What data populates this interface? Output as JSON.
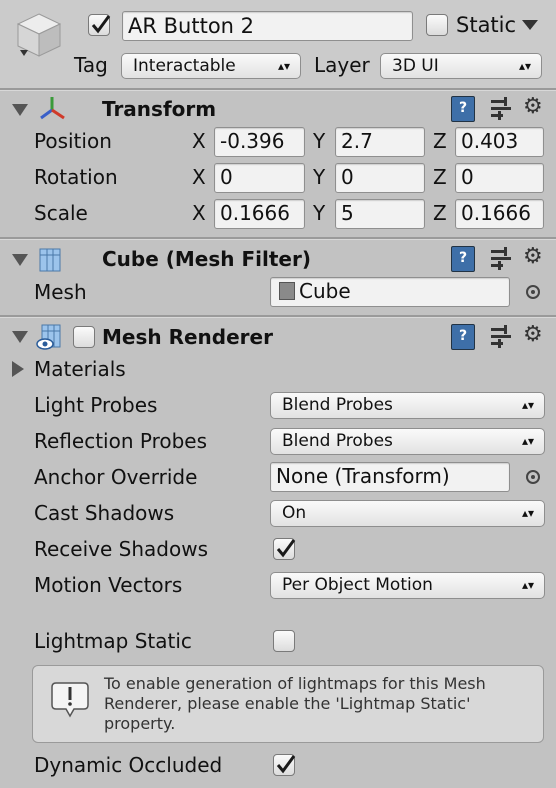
{
  "header": {
    "object_name": "AR Button 2",
    "static_label": "Static",
    "tag_label": "Tag",
    "tag_value": "Interactable",
    "layer_label": "Layer",
    "layer_value": "3D UI"
  },
  "transform": {
    "title": "Transform",
    "rows": [
      {
        "label": "Position",
        "x": "-0.396",
        "y": "2.7",
        "z": "0.403"
      },
      {
        "label": "Rotation",
        "x": "0",
        "y": "0",
        "z": "0"
      },
      {
        "label": "Scale",
        "x": "0.1666",
        "y": "5",
        "z": "0.1666"
      }
    ],
    "axis": {
      "x": "X",
      "y": "Y",
      "z": "Z"
    }
  },
  "mesh_filter": {
    "title": "Cube (Mesh Filter)",
    "mesh_label": "Mesh",
    "mesh_value": "Cube"
  },
  "mesh_renderer": {
    "title": "Mesh Renderer",
    "materials_label": "Materials",
    "light_probes_label": "Light Probes",
    "light_probes_value": "Blend Probes",
    "reflection_probes_label": "Reflection Probes",
    "reflection_probes_value": "Blend Probes",
    "anchor_override_label": "Anchor Override",
    "anchor_override_value": "None (Transform)",
    "cast_shadows_label": "Cast Shadows",
    "cast_shadows_value": "On",
    "receive_shadows_label": "Receive Shadows",
    "receive_shadows_checked": true,
    "motion_vectors_label": "Motion Vectors",
    "motion_vectors_value": "Per Object Motion",
    "lightmap_static_label": "Lightmap Static",
    "lightmap_static_checked": false,
    "help_line1": "To enable generation of lightmaps for this Mesh",
    "help_line2": "Renderer, please enable the 'Lightmap Static'",
    "help_line3": "property.",
    "dynamic_occluded_label": "Dynamic Occluded",
    "dynamic_occluded_checked": true
  }
}
